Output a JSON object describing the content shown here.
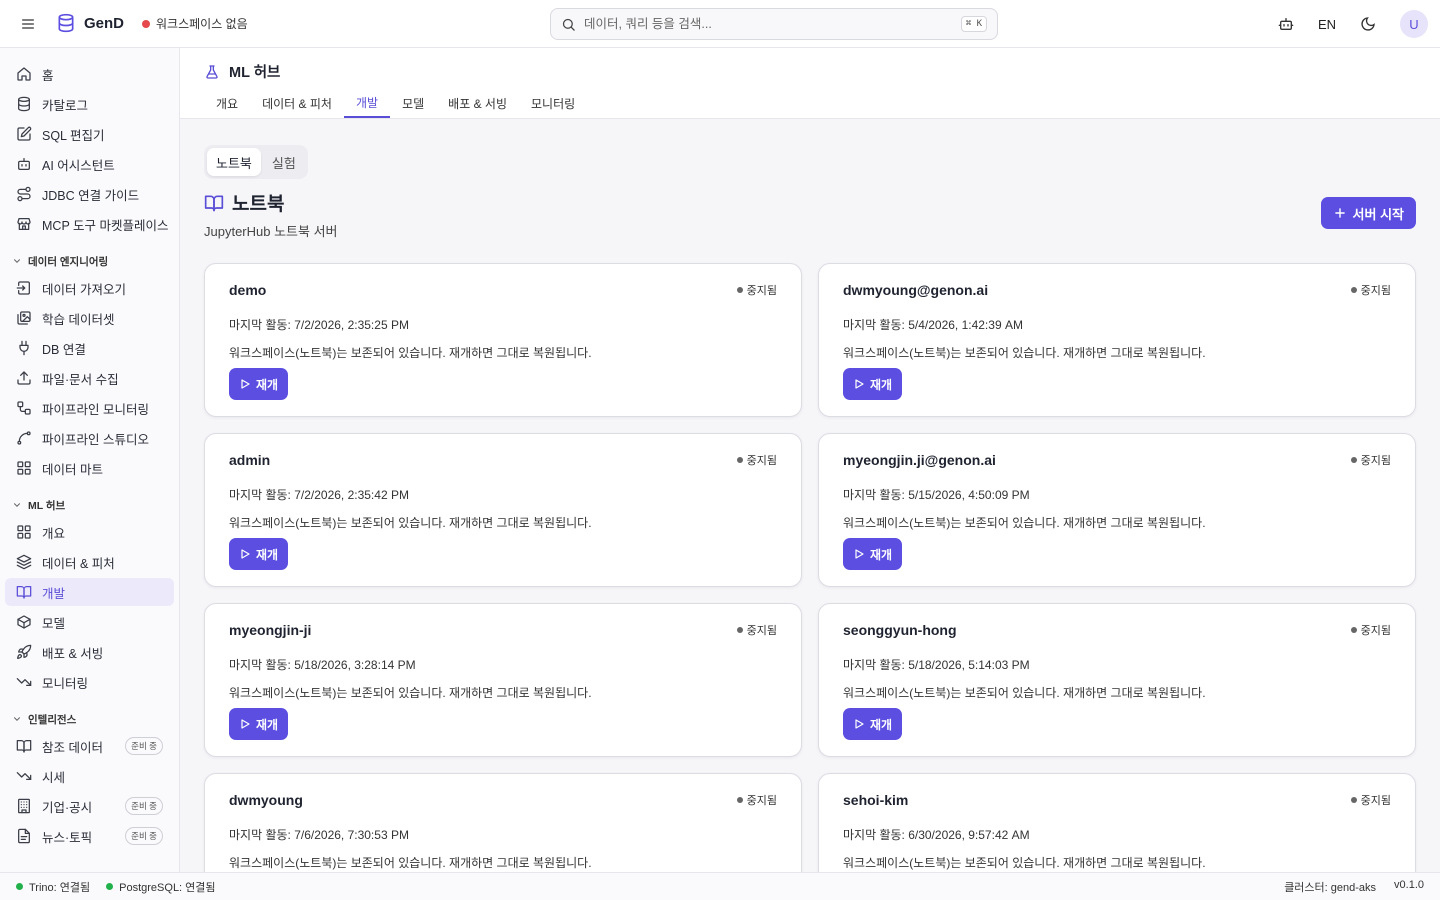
{
  "app": {
    "name": "GenD",
    "workspace_status": "워크스페이스 없음",
    "status_color": "#e5484d"
  },
  "search": {
    "placeholder": "데이터, 쿼리 등을 검색...",
    "shortcut": "⌘ K"
  },
  "top_right": {
    "lang": "EN",
    "avatar_initial": "U"
  },
  "sidebar": {
    "main_items": [
      {
        "label": "홈",
        "icon": "home-icon"
      },
      {
        "label": "카탈로그",
        "icon": "database-icon"
      },
      {
        "label": "SQL 편집기",
        "icon": "edit-icon"
      },
      {
        "label": "AI 어시스턴트",
        "icon": "bot-icon"
      },
      {
        "label": "JDBC 연결 가이드",
        "icon": "route-icon"
      },
      {
        "label": "MCP 도구 마켓플레이스",
        "icon": "store-icon"
      }
    ],
    "sections": [
      {
        "title": "데이터 엔지니어링",
        "items": [
          {
            "label": "데이터 가져오기",
            "icon": "import-icon"
          },
          {
            "label": "학습 데이터셋",
            "icon": "images-icon"
          },
          {
            "label": "DB 연결",
            "icon": "plug-icon"
          },
          {
            "label": "파일·문서 수집",
            "icon": "upload-icon"
          },
          {
            "label": "파이프라인 모니터링",
            "icon": "workflow-icon"
          },
          {
            "label": "파이프라인 스튜디오",
            "icon": "spline-icon"
          },
          {
            "label": "데이터 마트",
            "icon": "grid-icon"
          }
        ]
      },
      {
        "title": "ML 허브",
        "items": [
          {
            "label": "개요",
            "icon": "grid-icon"
          },
          {
            "label": "데이터 & 피처",
            "icon": "layers-icon"
          },
          {
            "label": "개발",
            "icon": "book-icon",
            "active": true
          },
          {
            "label": "모델",
            "icon": "box-icon"
          },
          {
            "label": "배포 & 서빙",
            "icon": "rocket-icon"
          },
          {
            "label": "모니터링",
            "icon": "trend-icon"
          }
        ]
      },
      {
        "title": "인텔리전스",
        "items": [
          {
            "label": "참조 데이터",
            "icon": "book-icon",
            "badge": "준비 중"
          },
          {
            "label": "시세",
            "icon": "trend-icon"
          },
          {
            "label": "기업·공시",
            "icon": "building-icon",
            "badge": "준비 중"
          },
          {
            "label": "뉴스·토픽",
            "icon": "file-icon",
            "badge": "준비 중"
          }
        ]
      }
    ]
  },
  "page": {
    "title": "ML 허브",
    "tabs": [
      "개요",
      "데이터 & 피처",
      "개발",
      "모델",
      "배포 & 서빙",
      "모니터링"
    ],
    "active_tab": 2,
    "segments": [
      "노트북",
      "실험"
    ],
    "section_title": "노트북",
    "section_subtitle": "JupyterHub 노트북 서버",
    "primary_button": "서버 시작",
    "accent_color": "#5b4ee0"
  },
  "notebooks": [
    {
      "name": "demo",
      "status": "중지됨",
      "last_activity": "마지막 활동: 7/2/2026, 2:35:25 PM",
      "desc": "워크스페이스(노트북)는 보존되어 있습니다. 재개하면 그대로 복원됩니다.",
      "action": "재개"
    },
    {
      "name": "dwmyoung@genon.ai",
      "status": "중지됨",
      "last_activity": "마지막 활동: 5/4/2026, 1:42:39 AM",
      "desc": "워크스페이스(노트북)는 보존되어 있습니다. 재개하면 그대로 복원됩니다.",
      "action": "재개"
    },
    {
      "name": "admin",
      "status": "중지됨",
      "last_activity": "마지막 활동: 7/2/2026, 2:35:42 PM",
      "desc": "워크스페이스(노트북)는 보존되어 있습니다. 재개하면 그대로 복원됩니다.",
      "action": "재개"
    },
    {
      "name": "myeongjin.ji@genon.ai",
      "status": "중지됨",
      "last_activity": "마지막 활동: 5/15/2026, 4:50:09 PM",
      "desc": "워크스페이스(노트북)는 보존되어 있습니다. 재개하면 그대로 복원됩니다.",
      "action": "재개"
    },
    {
      "name": "myeongjin-ji",
      "status": "중지됨",
      "last_activity": "마지막 활동: 5/18/2026, 3:28:14 PM",
      "desc": "워크스페이스(노트북)는 보존되어 있습니다. 재개하면 그대로 복원됩니다.",
      "action": "재개"
    },
    {
      "name": "seonggyun-hong",
      "status": "중지됨",
      "last_activity": "마지막 활동: 5/18/2026, 5:14:03 PM",
      "desc": "워크스페이스(노트북)는 보존되어 있습니다. 재개하면 그대로 복원됩니다.",
      "action": "재개"
    },
    {
      "name": "dwmyoung",
      "status": "중지됨",
      "last_activity": "마지막 활동: 7/6/2026, 7:30:53 PM",
      "desc": "워크스페이스(노트북)는 보존되어 있습니다. 재개하면 그대로 복원됩니다.",
      "action": "재개"
    },
    {
      "name": "sehoi-kim",
      "status": "중지됨",
      "last_activity": "마지막 활동: 6/30/2026, 9:57:42 AM",
      "desc": "워크스페이스(노트북)는 보존되어 있습니다. 재개하면 그대로 복원됩니다.",
      "action": "재개"
    }
  ],
  "statusbar": {
    "trino": "Trino: 연결됨",
    "postgres": "PostgreSQL: 연결됨",
    "cluster": "클러스터: gend-aks",
    "version": "v0.1.0",
    "connected_color": "#22b04b"
  }
}
